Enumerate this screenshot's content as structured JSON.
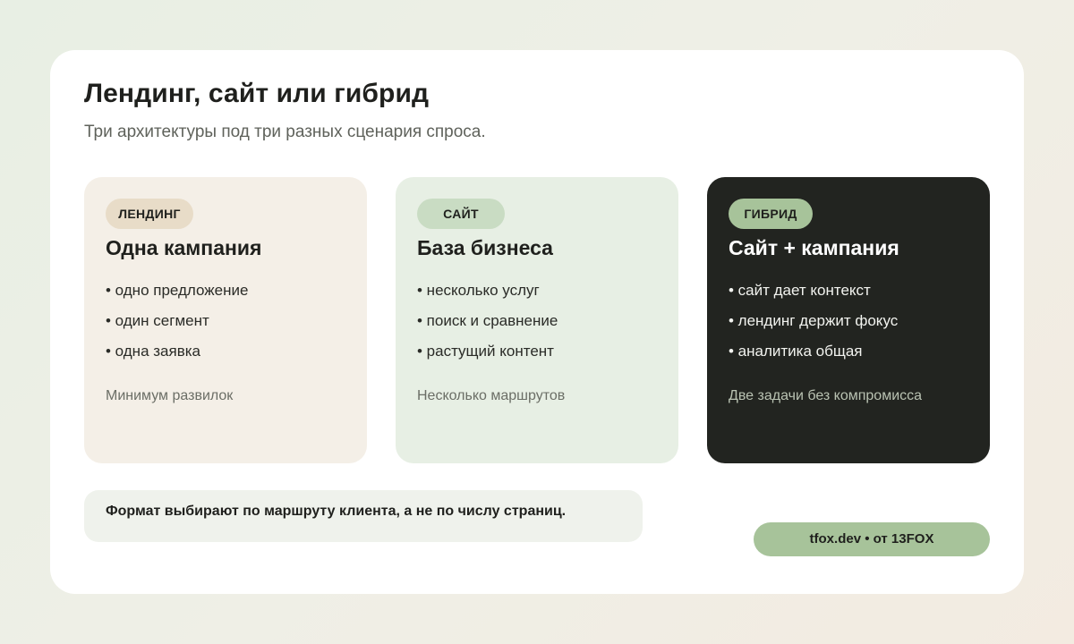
{
  "header": {
    "title": "Лендинг, сайт или гибрид",
    "subtitle": "Три архитектуры под три разных сценария спроса."
  },
  "cards": [
    {
      "tag": "ЛЕНДИНГ",
      "title": "Одна кампания",
      "bullets": [
        "• одно предложение",
        "• один сегмент",
        "• одна заявка"
      ],
      "footer": "Минимум развилок"
    },
    {
      "tag": "САЙТ",
      "title": "База бизнеса",
      "bullets": [
        "• несколько услуг",
        "• поиск и сравнение",
        "• растущий контент"
      ],
      "footer": "Несколько маршрутов"
    },
    {
      "tag": "ГИБРИД",
      "title": "Сайт + кампания",
      "bullets": [
        "• сайт дает контекст",
        "• лендинг держит фокус",
        "• аналитика общая"
      ],
      "footer": "Две задачи без компромисса"
    }
  ],
  "note": "Формат выбирают по маршруту клиента, а не по числу страниц.",
  "attribution": "tfox.dev • от 13FOX",
  "colors": {
    "landing_bg": "#f4efe7",
    "site_bg": "#e7efe4",
    "hybrid_bg": "#222420",
    "accent_green": "#a7c39a"
  }
}
